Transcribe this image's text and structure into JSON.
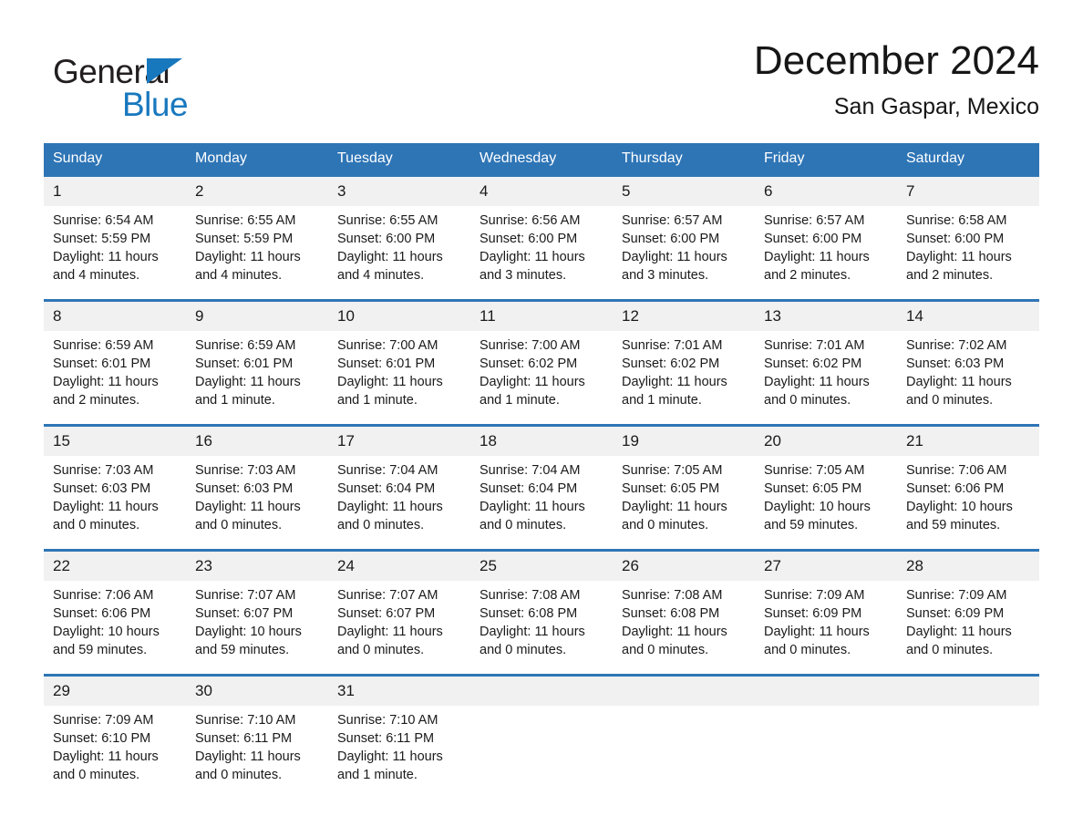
{
  "brand": {
    "name_top": "General",
    "name_bottom": "Blue",
    "triangle_icon": "triangle-icon",
    "color_blue": "#1878be",
    "color_black": "#231f20"
  },
  "header": {
    "title": "December 2024",
    "subtitle": "San Gaspar, Mexico"
  },
  "theme": {
    "header_blue": "#2e75b6",
    "daynum_band": "#f1f1f1",
    "text": "#1a1a1a",
    "page_background": "#ffffff"
  },
  "weekdays": [
    "Sunday",
    "Monday",
    "Tuesday",
    "Wednesday",
    "Thursday",
    "Friday",
    "Saturday"
  ],
  "labels": {
    "sunrise_prefix": "Sunrise:",
    "sunset_prefix": "Sunset:",
    "daylight_prefix": "Daylight:"
  },
  "weeks": [
    [
      {
        "day": "1",
        "sunrise": "Sunrise: 6:54 AM",
        "sunset": "Sunset: 5:59 PM",
        "daylight_line1": "Daylight: 11 hours",
        "daylight_line2": "and 4 minutes."
      },
      {
        "day": "2",
        "sunrise": "Sunrise: 6:55 AM",
        "sunset": "Sunset: 5:59 PM",
        "daylight_line1": "Daylight: 11 hours",
        "daylight_line2": "and 4 minutes."
      },
      {
        "day": "3",
        "sunrise": "Sunrise: 6:55 AM",
        "sunset": "Sunset: 6:00 PM",
        "daylight_line1": "Daylight: 11 hours",
        "daylight_line2": "and 4 minutes."
      },
      {
        "day": "4",
        "sunrise": "Sunrise: 6:56 AM",
        "sunset": "Sunset: 6:00 PM",
        "daylight_line1": "Daylight: 11 hours",
        "daylight_line2": "and 3 minutes."
      },
      {
        "day": "5",
        "sunrise": "Sunrise: 6:57 AM",
        "sunset": "Sunset: 6:00 PM",
        "daylight_line1": "Daylight: 11 hours",
        "daylight_line2": "and 3 minutes."
      },
      {
        "day": "6",
        "sunrise": "Sunrise: 6:57 AM",
        "sunset": "Sunset: 6:00 PM",
        "daylight_line1": "Daylight: 11 hours",
        "daylight_line2": "and 2 minutes."
      },
      {
        "day": "7",
        "sunrise": "Sunrise: 6:58 AM",
        "sunset": "Sunset: 6:00 PM",
        "daylight_line1": "Daylight: 11 hours",
        "daylight_line2": "and 2 minutes."
      }
    ],
    [
      {
        "day": "8",
        "sunrise": "Sunrise: 6:59 AM",
        "sunset": "Sunset: 6:01 PM",
        "daylight_line1": "Daylight: 11 hours",
        "daylight_line2": "and 2 minutes."
      },
      {
        "day": "9",
        "sunrise": "Sunrise: 6:59 AM",
        "sunset": "Sunset: 6:01 PM",
        "daylight_line1": "Daylight: 11 hours",
        "daylight_line2": "and 1 minute."
      },
      {
        "day": "10",
        "sunrise": "Sunrise: 7:00 AM",
        "sunset": "Sunset: 6:01 PM",
        "daylight_line1": "Daylight: 11 hours",
        "daylight_line2": "and 1 minute."
      },
      {
        "day": "11",
        "sunrise": "Sunrise: 7:00 AM",
        "sunset": "Sunset: 6:02 PM",
        "daylight_line1": "Daylight: 11 hours",
        "daylight_line2": "and 1 minute."
      },
      {
        "day": "12",
        "sunrise": "Sunrise: 7:01 AM",
        "sunset": "Sunset: 6:02 PM",
        "daylight_line1": "Daylight: 11 hours",
        "daylight_line2": "and 1 minute."
      },
      {
        "day": "13",
        "sunrise": "Sunrise: 7:01 AM",
        "sunset": "Sunset: 6:02 PM",
        "daylight_line1": "Daylight: 11 hours",
        "daylight_line2": "and 0 minutes."
      },
      {
        "day": "14",
        "sunrise": "Sunrise: 7:02 AM",
        "sunset": "Sunset: 6:03 PM",
        "daylight_line1": "Daylight: 11 hours",
        "daylight_line2": "and 0 minutes."
      }
    ],
    [
      {
        "day": "15",
        "sunrise": "Sunrise: 7:03 AM",
        "sunset": "Sunset: 6:03 PM",
        "daylight_line1": "Daylight: 11 hours",
        "daylight_line2": "and 0 minutes."
      },
      {
        "day": "16",
        "sunrise": "Sunrise: 7:03 AM",
        "sunset": "Sunset: 6:03 PM",
        "daylight_line1": "Daylight: 11 hours",
        "daylight_line2": "and 0 minutes."
      },
      {
        "day": "17",
        "sunrise": "Sunrise: 7:04 AM",
        "sunset": "Sunset: 6:04 PM",
        "daylight_line1": "Daylight: 11 hours",
        "daylight_line2": "and 0 minutes."
      },
      {
        "day": "18",
        "sunrise": "Sunrise: 7:04 AM",
        "sunset": "Sunset: 6:04 PM",
        "daylight_line1": "Daylight: 11 hours",
        "daylight_line2": "and 0 minutes."
      },
      {
        "day": "19",
        "sunrise": "Sunrise: 7:05 AM",
        "sunset": "Sunset: 6:05 PM",
        "daylight_line1": "Daylight: 11 hours",
        "daylight_line2": "and 0 minutes."
      },
      {
        "day": "20",
        "sunrise": "Sunrise: 7:05 AM",
        "sunset": "Sunset: 6:05 PM",
        "daylight_line1": "Daylight: 10 hours",
        "daylight_line2": "and 59 minutes."
      },
      {
        "day": "21",
        "sunrise": "Sunrise: 7:06 AM",
        "sunset": "Sunset: 6:06 PM",
        "daylight_line1": "Daylight: 10 hours",
        "daylight_line2": "and 59 minutes."
      }
    ],
    [
      {
        "day": "22",
        "sunrise": "Sunrise: 7:06 AM",
        "sunset": "Sunset: 6:06 PM",
        "daylight_line1": "Daylight: 10 hours",
        "daylight_line2": "and 59 minutes."
      },
      {
        "day": "23",
        "sunrise": "Sunrise: 7:07 AM",
        "sunset": "Sunset: 6:07 PM",
        "daylight_line1": "Daylight: 10 hours",
        "daylight_line2": "and 59 minutes."
      },
      {
        "day": "24",
        "sunrise": "Sunrise: 7:07 AM",
        "sunset": "Sunset: 6:07 PM",
        "daylight_line1": "Daylight: 11 hours",
        "daylight_line2": "and 0 minutes."
      },
      {
        "day": "25",
        "sunrise": "Sunrise: 7:08 AM",
        "sunset": "Sunset: 6:08 PM",
        "daylight_line1": "Daylight: 11 hours",
        "daylight_line2": "and 0 minutes."
      },
      {
        "day": "26",
        "sunrise": "Sunrise: 7:08 AM",
        "sunset": "Sunset: 6:08 PM",
        "daylight_line1": "Daylight: 11 hours",
        "daylight_line2": "and 0 minutes."
      },
      {
        "day": "27",
        "sunrise": "Sunrise: 7:09 AM",
        "sunset": "Sunset: 6:09 PM",
        "daylight_line1": "Daylight: 11 hours",
        "daylight_line2": "and 0 minutes."
      },
      {
        "day": "28",
        "sunrise": "Sunrise: 7:09 AM",
        "sunset": "Sunset: 6:09 PM",
        "daylight_line1": "Daylight: 11 hours",
        "daylight_line2": "and 0 minutes."
      }
    ],
    [
      {
        "day": "29",
        "sunrise": "Sunrise: 7:09 AM",
        "sunset": "Sunset: 6:10 PM",
        "daylight_line1": "Daylight: 11 hours",
        "daylight_line2": "and 0 minutes."
      },
      {
        "day": "30",
        "sunrise": "Sunrise: 7:10 AM",
        "sunset": "Sunset: 6:11 PM",
        "daylight_line1": "Daylight: 11 hours",
        "daylight_line2": "and 0 minutes."
      },
      {
        "day": "31",
        "sunrise": "Sunrise: 7:10 AM",
        "sunset": "Sunset: 6:11 PM",
        "daylight_line1": "Daylight: 11 hours",
        "daylight_line2": "and 1 minute."
      },
      {
        "day": "",
        "sunrise": "",
        "sunset": "",
        "daylight_line1": "",
        "daylight_line2": ""
      },
      {
        "day": "",
        "sunrise": "",
        "sunset": "",
        "daylight_line1": "",
        "daylight_line2": ""
      },
      {
        "day": "",
        "sunrise": "",
        "sunset": "",
        "daylight_line1": "",
        "daylight_line2": ""
      },
      {
        "day": "",
        "sunrise": "",
        "sunset": "",
        "daylight_line1": "",
        "daylight_line2": ""
      }
    ]
  ]
}
